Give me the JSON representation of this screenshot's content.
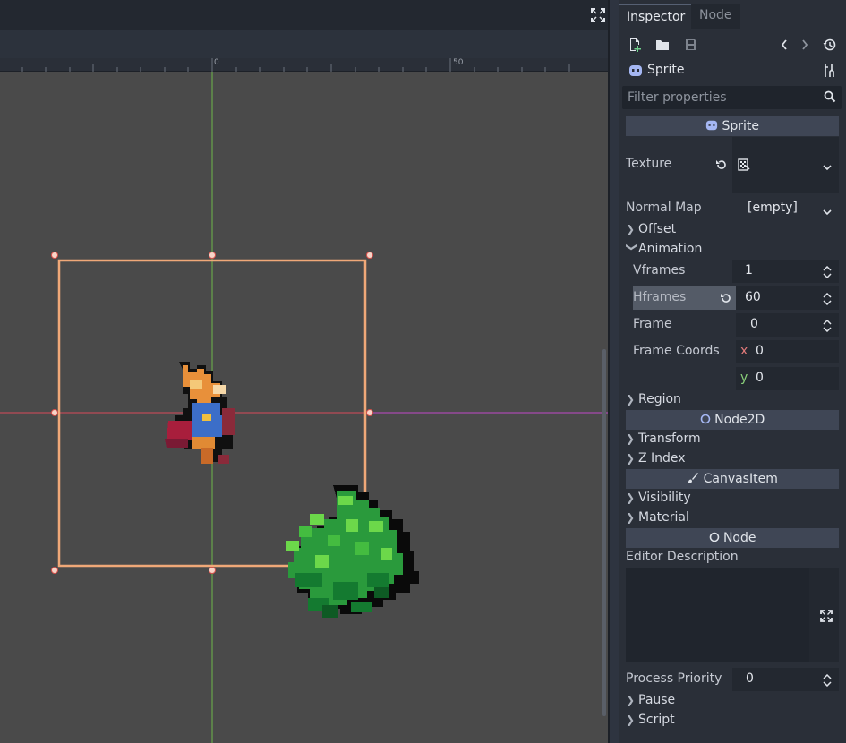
{
  "ruler": {
    "origin": "0",
    "mark50": "50"
  },
  "inspector": {
    "tabs": {
      "inspector": "Inspector",
      "node": "Node"
    },
    "object_name": "Sprite",
    "filter_placeholder": "Filter properties",
    "sections": {
      "sprite": "Sprite",
      "node2d": "Node2D",
      "canvasitem": "CanvasItem",
      "node": "Node"
    },
    "props": {
      "texture": "Texture",
      "normal_map": {
        "label": "Normal Map",
        "value": "[empty]"
      },
      "offset": "Offset",
      "animation": "Animation",
      "vframes": {
        "label": "Vframes",
        "value": "1"
      },
      "hframes": {
        "label": "Hframes",
        "value": "60"
      },
      "frame": {
        "label": "Frame",
        "value": "0"
      },
      "frame_coords": {
        "label": "Frame Coords",
        "x_label": "x",
        "x": "0",
        "y_label": "y",
        "y": "0"
      },
      "region": "Region",
      "transform": "Transform",
      "z_index": "Z Index",
      "visibility": "Visibility",
      "material": "Material",
      "editor_description": "Editor Description",
      "process_priority": {
        "label": "Process Priority",
        "value": "0"
      },
      "pause": "Pause",
      "script": "Script"
    }
  },
  "colors": {
    "selection": "#f0a878",
    "axis_x": "#d84a5a",
    "axis_y": "#6fb84a",
    "section_bg": "#3f4655"
  }
}
